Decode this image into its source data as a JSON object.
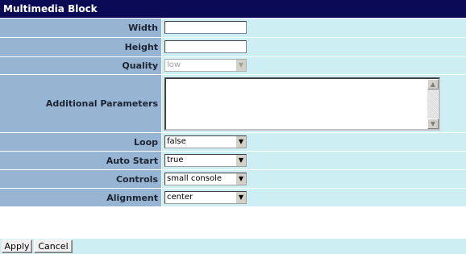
{
  "title": "Multimedia Block",
  "fields": {
    "width": {
      "label": "Width",
      "value": ""
    },
    "height": {
      "label": "Height",
      "value": ""
    },
    "quality": {
      "label": "Quality",
      "value": "low"
    },
    "additional_parameters": {
      "label": "Additional Parameters",
      "value": ""
    },
    "loop": {
      "label": "Loop",
      "value": "false"
    },
    "auto_start": {
      "label": "Auto Start",
      "value": "true"
    },
    "controls": {
      "label": "Controls",
      "value": "small console"
    },
    "alignment": {
      "label": "Alignment",
      "value": "center"
    }
  },
  "buttons": {
    "apply": "Apply",
    "cancel": "Cancel"
  },
  "icons": {
    "dropdown": "chevron-down-icon",
    "scroll_up": "arrow-up-icon",
    "scroll_down": "arrow-down-icon"
  },
  "colors": {
    "title_bg": "#0a0a55",
    "label_bg": "#97b5d3",
    "field_bg": "#cdeef3"
  }
}
